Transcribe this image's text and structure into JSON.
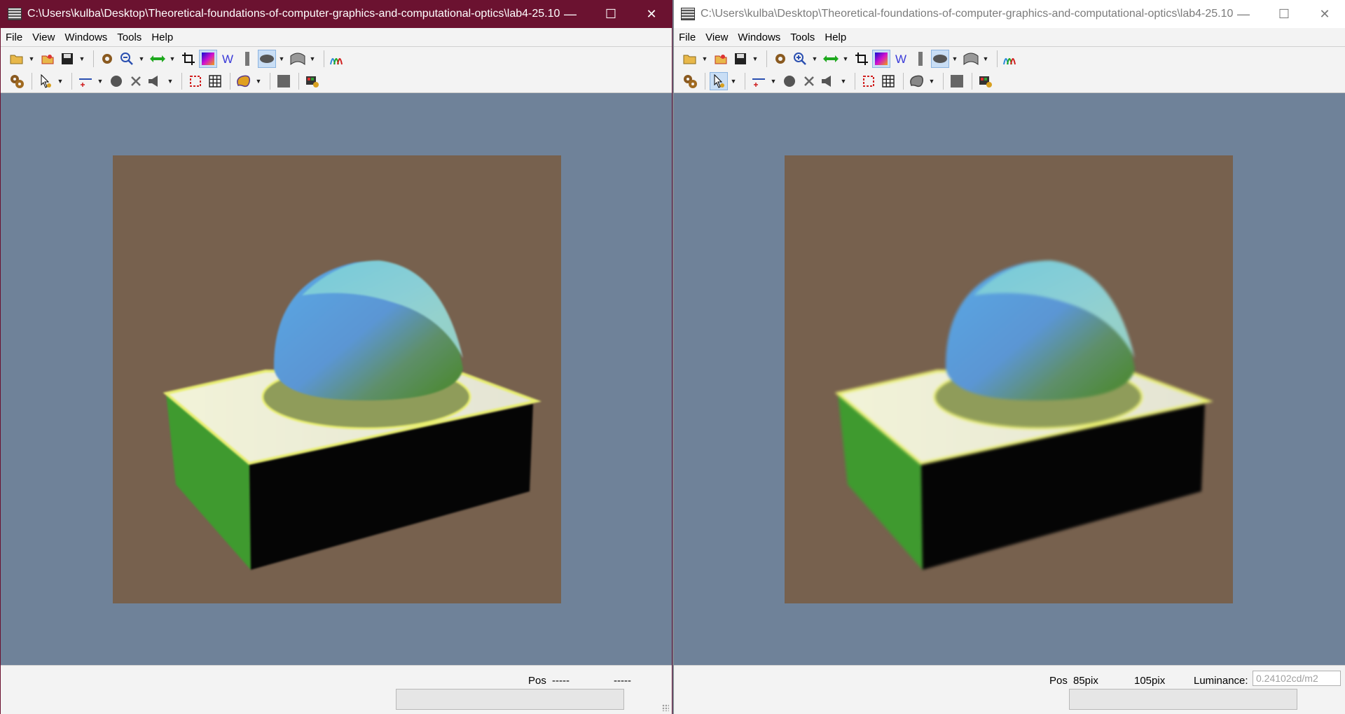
{
  "windows": [
    {
      "title": "C:\\Users\\kulba\\Desktop\\Theoretical-foundations-of-computer-graphics-and-computational-optics\\lab4-25.10....",
      "menu": [
        "File",
        "View",
        "Windows",
        "Tools",
        "Help"
      ],
      "status": {
        "pos_label": "Pos",
        "pos_x": "-----",
        "pos_y": "-----"
      }
    },
    {
      "title": "C:\\Users\\kulba\\Desktop\\Theoretical-foundations-of-computer-graphics-and-computational-optics\\lab4-25.10....",
      "menu": [
        "File",
        "View",
        "Windows",
        "Tools",
        "Help"
      ],
      "status": {
        "pos_label": "Pos",
        "pos_x": "85pix",
        "pos_y": "105pix",
        "luminance_label": "Luminance:",
        "luminance_value": "0.24102cd/m2"
      }
    }
  ],
  "window_controls": {
    "minimize": "—",
    "maximize": "☐",
    "close": "✕"
  },
  "colors": {
    "active_titlebar": "#6b1230",
    "viewport_bg": "#6f8299",
    "render_bg": "#77614e"
  }
}
